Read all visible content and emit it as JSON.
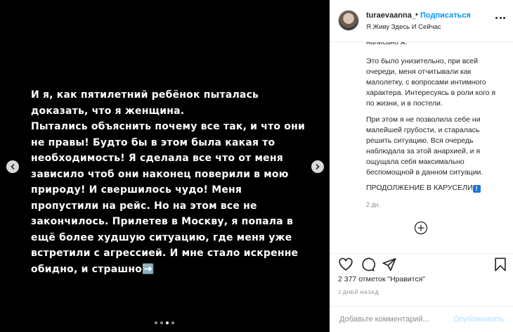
{
  "slide": {
    "text": "И я, как пятилетний ребёнок пыталась доказать, что я женщина.\nПытались объяснить почему все так, и что они не правы! Будто бы в этом была какая то необходимость! Я сделала все что от меня зависило чтоб они наконец поверили в мою природу! И свершилось чудо! Меня пропустили на рейс. Но на этом все не закончилось. Прилетев в Москву, я попала в ещё более худшую ситуацию, где меня уже встретили с агрессией. И мне стало искренне обидно, и страшно",
    "arrow_emoji": "➡️",
    "dots_count": 4,
    "active_dot": 2
  },
  "header": {
    "username": "turaevaanna_",
    "bullet": "•",
    "follow_label": "Подписаться",
    "location": "Я Живу Здесь И Сейчас"
  },
  "caption": {
    "cut_line": "написано ж.",
    "para1": "Это было унизительно, при всей очереди, меня отчитывали как малолетку, с вопросами интимного характера. Интересуясь в роли кого я по жизни, и в постели.",
    "para2": "При этом я не позволила себе ни малейшей грубости, и старалась решить ситуацию. Вся очередь наблюдала за этой анархией, и я ощущала себя максимально беспомощной в данном ситуации.",
    "para3": "ПРОДОЛЖЕНИЕ В КАРУСЕЛИ",
    "flag_glyph": "!",
    "time_ago": "2 дн."
  },
  "actions": {
    "likes": "2 377 отметок \"Нравится\"",
    "date": "2 ДНЕЙ НАЗАД",
    "comment_placeholder": "Добавьте комментарий...",
    "publish_label": "Опубликовать"
  },
  "icons": {
    "prev": "chevron-left-icon",
    "next": "chevron-right-icon",
    "more": "more-dots-icon",
    "add": "plus-circle-icon",
    "like": "heart-icon",
    "comment": "comment-icon",
    "share": "share-icon",
    "save": "bookmark-icon"
  },
  "colors": {
    "media_bg": "#000000",
    "accent": "#0095f6",
    "publish_disabled": "#b2dffc",
    "muted": "#8e8e8e"
  }
}
